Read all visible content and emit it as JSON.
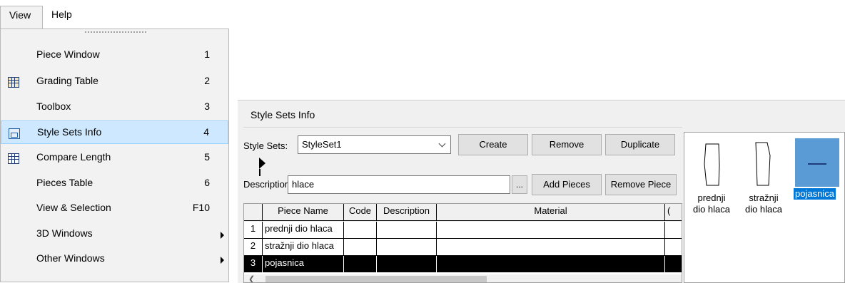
{
  "menubar": {
    "view": "View",
    "help": "Help"
  },
  "menu": {
    "items": [
      {
        "label": "Piece Window",
        "shortcut": "1"
      },
      {
        "label": "Grading Table",
        "shortcut": "2",
        "icon": "grading-table-icon"
      },
      {
        "label": "Toolbox",
        "shortcut": "3"
      },
      {
        "label": "Style Sets Info",
        "shortcut": "4",
        "icon": "style-sets-icon",
        "highlighted": true
      },
      {
        "label": "Compare Length",
        "shortcut": "5",
        "icon": "compare-length-icon"
      },
      {
        "label": "Pieces Table",
        "shortcut": "6"
      },
      {
        "label": "View & Selection",
        "shortcut": "F10"
      },
      {
        "label": "3D Windows",
        "submenu": true
      },
      {
        "label": "Other Windows",
        "submenu": true
      }
    ]
  },
  "panel": {
    "title": "Style Sets Info",
    "style_sets_label": "Style Sets:",
    "style_set_value": "StyleSet1",
    "create": "Create",
    "remove": "Remove",
    "duplicate": "Duplicate",
    "description_label": "Description:",
    "description_value": "hlace",
    "ellipsis": "...",
    "add_pieces": "Add Pieces",
    "remove_piece": "Remove Piece",
    "table": {
      "headers": [
        "Piece Name",
        "Code",
        "Description",
        "Material",
        "("
      ],
      "rows": [
        {
          "num": "1",
          "name": "prednji dio hlaca"
        },
        {
          "num": "2",
          "name": "stražnji dio hlaca"
        },
        {
          "num": "3",
          "name": "pojasnica",
          "selected": true
        }
      ]
    },
    "pieces": [
      {
        "label1": "prednji",
        "label2": "dio hlaca"
      },
      {
        "label1": "stražnji",
        "label2": "dio hlaca"
      },
      {
        "label1": "pojasnica",
        "selected": true
      }
    ]
  },
  "colors": {
    "menu_highlight": "#cde8ff",
    "selection": "#0078d7",
    "row_selected": "#000000"
  }
}
